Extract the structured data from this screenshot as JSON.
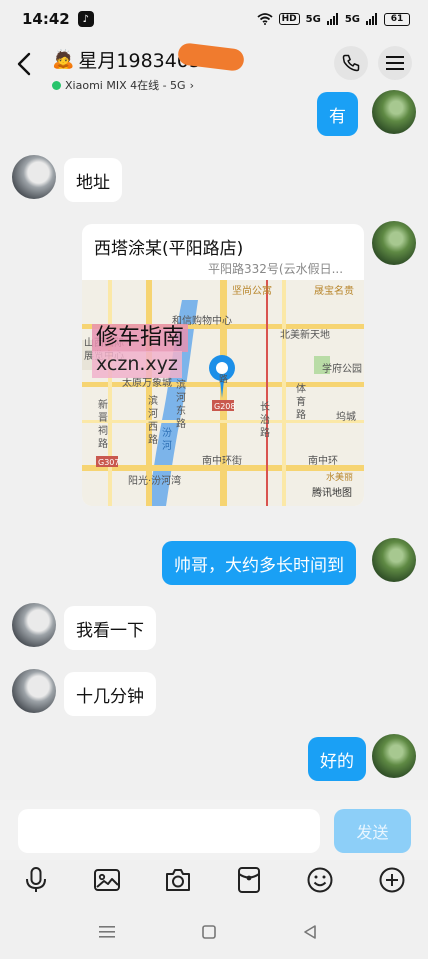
{
  "status": {
    "time": "14:42",
    "hd": "HD",
    "net1": "5G",
    "net2": "5G",
    "battery": "61"
  },
  "header": {
    "title_emoji": "🙇",
    "title": "星月19834034",
    "device_status": "Xiaomi MIX 4在线 - 5G",
    "chevron": "›"
  },
  "messages": [
    {
      "side": "out",
      "type": "text",
      "text": "有"
    },
    {
      "side": "in",
      "type": "text",
      "text": "地址"
    },
    {
      "side": "out",
      "type": "location",
      "title": "西塔涂某(平阳路店)",
      "address": "平阳路332号(云水假日..."
    },
    {
      "side": "out",
      "type": "text",
      "text": "帅哥，大约多长时间到"
    },
    {
      "side": "in",
      "type": "text",
      "text": "我看一下"
    },
    {
      "side": "in",
      "type": "text",
      "text": "十几分钟"
    },
    {
      "side": "out",
      "type": "text",
      "text": "好的"
    }
  ],
  "map": {
    "labels": {
      "top1": "坚尚公寓",
      "top2": "晟宝名贵",
      "mall": "和信购物中心",
      "beimei": "北美新天地",
      "shanxi1": "山西国际",
      "shanxi2": "展览中心",
      "xuefu": "学府公园",
      "taiyuan": "太原万象城",
      "xinjin1": "新",
      "xinjin2": "晋",
      "xinjin3": "祠",
      "xinjin4": "路",
      "binhe_w1": "滨",
      "binhe_w2": "河",
      "binhe_w3": "西",
      "binhe_w4": "路",
      "binhe_e1": "滨",
      "binhe_e2": "河",
      "binhe_e3": "东",
      "binhe_e4": "路",
      "fen1": "汾",
      "fen2": "河",
      "changzhi1": "长",
      "changzhi2": "治",
      "changzhi3": "路",
      "tiyu1": "体",
      "tiyu2": "育",
      "tiyu3": "路",
      "wucheng": "坞城",
      "nanzhong": "南中环街",
      "nanzhong2": "南中环",
      "g208": "G208",
      "g307": "G307",
      "yangguang": "阳光·汾河湾",
      "lu": "路",
      "logo": "腾讯地图",
      "bottom_label": "水美丽"
    },
    "accent": "#1c8fe8"
  },
  "watermark": {
    "top": "修车指南",
    "bottom": "xczn.xyz"
  },
  "composer": {
    "input_value": "",
    "send_label": "发送"
  },
  "toolbar": [
    "mic-icon",
    "image-icon",
    "camera-icon",
    "red-packet-icon",
    "emoji-icon",
    "plus-icon"
  ],
  "colors": {
    "out_bubble": "#1aa0f5",
    "send_disabled": "#8dcff8",
    "online_dot": "#27c46b"
  }
}
